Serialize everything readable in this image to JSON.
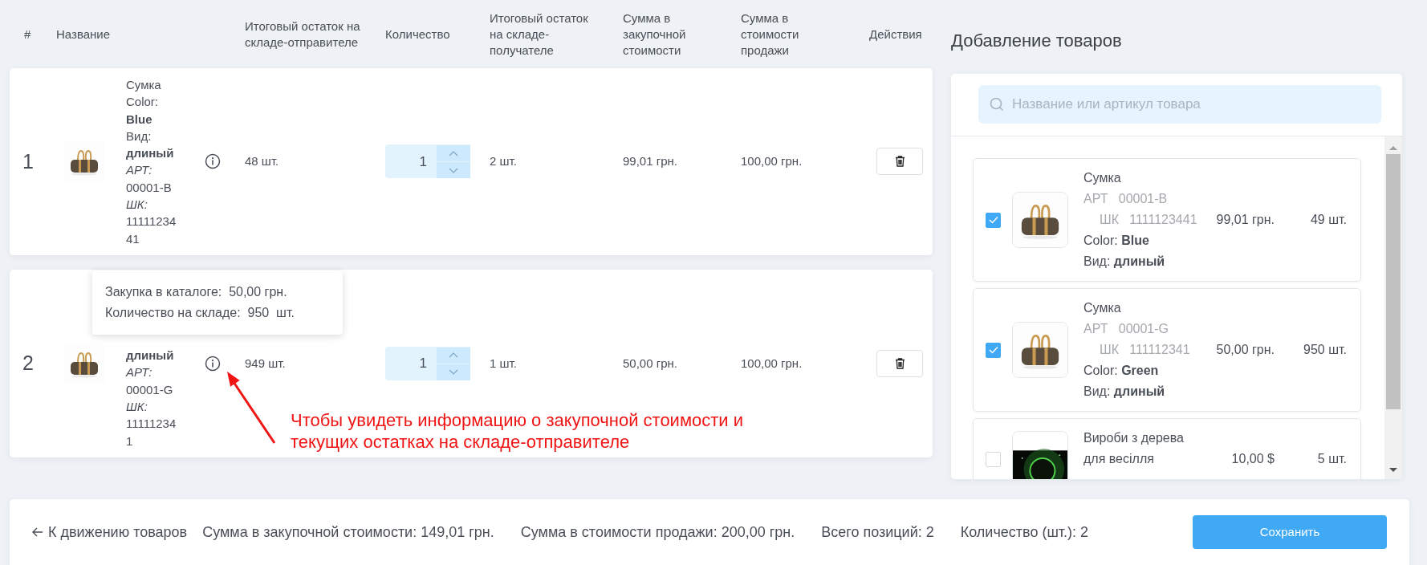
{
  "table": {
    "columns": [
      "#",
      "Название",
      "Итоговый остаток на складе-отправителе",
      "Количество",
      "Итоговый остаток на складе-получателе",
      "Сумма в закупочной стоимости",
      "Сумма в стоимости продажи",
      "Действия"
    ],
    "rows": [
      {
        "number": "1",
        "name_lines": [
          {
            "text": "Сумка",
            "kind": "plain"
          },
          {
            "text": "Color:",
            "kind": "plain"
          },
          {
            "text": "Blue",
            "kind": "bold"
          },
          {
            "text": "Вид:",
            "kind": "plain"
          },
          {
            "text": "длиный",
            "kind": "bold"
          },
          {
            "text": "АРТ:",
            "kind": "italic"
          },
          {
            "text": "00001-B",
            "kind": "plain"
          },
          {
            "text": "ШК:",
            "kind": "italic"
          },
          {
            "text": "1111123441",
            "kind": "plain"
          }
        ],
        "stock_sender": "48 шт.",
        "quantity": "1",
        "stock_receiver": "2 шт.",
        "purchase_sum": "99,01 грн.",
        "sale_sum": "100,00 грн."
      },
      {
        "number": "2",
        "name_lines": [
          {
            "text": "длиный",
            "kind": "bold"
          },
          {
            "text": "АРТ:",
            "kind": "italic"
          },
          {
            "text": "00001-G",
            "kind": "plain"
          },
          {
            "text": "ШК:",
            "kind": "italic"
          },
          {
            "text": "111112341",
            "kind": "plain"
          }
        ],
        "stock_sender": "949 шт.",
        "quantity": "1",
        "stock_receiver": "1 шт.",
        "purchase_sum": "50,00 грн.",
        "sale_sum": "100,00 грн.",
        "tooltip": {
          "lines": [
            "Закупка в каталоге:  50,00 грн.",
            "Количество на складе:  950  шт."
          ]
        },
        "annotation": {
          "lines": [
            "Чтобы увидеть информацию о закупочной стоимости и",
            "текущих остатках на складе-отправителе"
          ]
        }
      }
    ]
  },
  "add_panel": {
    "title": "Добавление товаров",
    "search": {
      "placeholder": "Название или артикул товара"
    },
    "products": [
      {
        "checked": true,
        "name": "Сумка",
        "art_label": "АРТ",
        "art": "00001-B",
        "barcode_label": "ШК",
        "barcode": "1111123441",
        "price": "99,01 грн.",
        "stock": "49 шт.",
        "attributes": [
          {
            "label": "Color:",
            "value": "Blue"
          },
          {
            "label": "Вид:",
            "value": "длиный"
          }
        ]
      },
      {
        "checked": true,
        "name": "Сумка",
        "art_label": "АРТ",
        "art": "00001-G",
        "barcode_label": "ШК",
        "barcode": "111112341",
        "price": "50,00 грн.",
        "stock": "950 шт.",
        "attributes": [
          {
            "label": "Color:",
            "value": "Green"
          },
          {
            "label": "Вид:",
            "value": "длиный"
          }
        ]
      },
      {
        "checked": false,
        "name": "Вироби з дерева для весілля",
        "price": "10,00 $",
        "stock": "5 шт."
      }
    ]
  },
  "footer": {
    "back_link": "К движению товаров",
    "purchase_total": "Сумма в закупочной стоимости: 149,01 грн.",
    "sale_total": "Сумма в стоимости продажи: 200,00 грн.",
    "positions": "Всего позиций: 2",
    "quantity_total": "Количество (шт.): 2",
    "save_button": "Сохранить"
  }
}
